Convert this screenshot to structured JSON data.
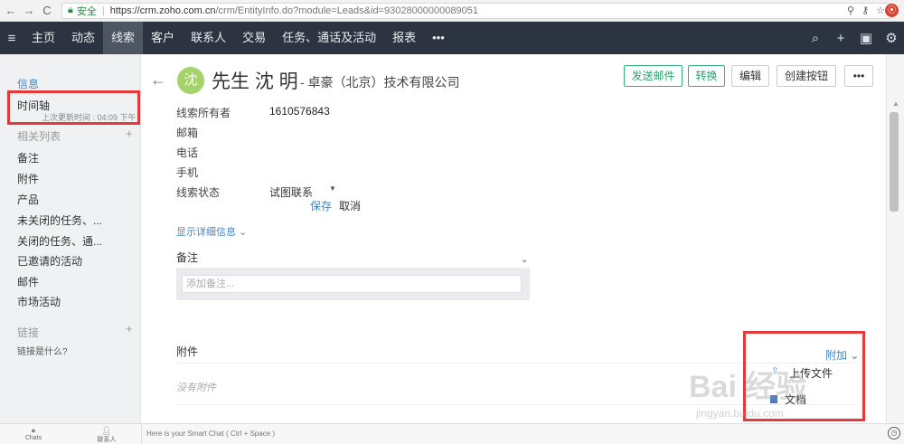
{
  "browser": {
    "back": "←",
    "forward": "→",
    "reload": "C",
    "secure_label": "安全",
    "url_host": "https://crm.zoho.com.cn",
    "url_rest": "/crm/EntityInfo.do?module=Leads&id=93028000000089051",
    "icons": [
      "search-icon",
      "key-icon",
      "star-icon"
    ]
  },
  "topnav": {
    "items": [
      "主页",
      "动态",
      "线索",
      "客户",
      "联系人",
      "交易",
      "任务、通话及活动",
      "报表",
      "•••"
    ],
    "active_index": 2,
    "right_icons": [
      "search-icon",
      "plus-icon",
      "calendar-icon",
      "settings-icon"
    ]
  },
  "sidebar": {
    "info": "信息",
    "timeline": "时间轴",
    "last_updated": "上次更新时间 : 04:09 下午",
    "related_list": "相关列表",
    "related_items": [
      "备注",
      "附件",
      "产品",
      "未关闭的任务、...",
      "关闭的任务、通...",
      "已邀请的活动",
      "邮件",
      "市场活动"
    ],
    "links": "链接",
    "what_is_link": "链接是什么?"
  },
  "record": {
    "avatar_initial": "沈",
    "name": "先生 沈 明",
    "company": "- 卓豪（北京）技术有限公司",
    "buttons": {
      "send_email": "发送邮件",
      "convert": "转换",
      "edit": "编辑",
      "create_button": "创建按钮",
      "more": "•••"
    },
    "fields": [
      {
        "label": "线索所有者",
        "value": "1610576843"
      },
      {
        "label": "邮箱",
        "value": ""
      },
      {
        "label": "电话",
        "value": ""
      },
      {
        "label": "手机",
        "value": ""
      }
    ],
    "status_label": "线索状态",
    "status_value": "试图联系",
    "save": "保存",
    "cancel": "取消",
    "show_details": "显示详细信息 ⌄"
  },
  "notes": {
    "title": "备注",
    "placeholder": "添加备注..."
  },
  "attachments": {
    "title": "附件",
    "empty": "没有附件",
    "attach_link": "附加 ⌄",
    "menu": [
      "上传文件",
      "文档"
    ]
  },
  "footer": {
    "chats": "Chats",
    "contacts": "联系人",
    "smartchat": "Here is your Smart Chat ( Ctrl + Space )"
  },
  "watermark": {
    "main": "Bai 经验",
    "sub": "jingyan.baidu.com"
  },
  "colors": {
    "nav_bg": "#2b3440",
    "accent_blue": "#3f88c5",
    "accent_green": "#34b07d",
    "highlight_red": "#e63a3a"
  }
}
